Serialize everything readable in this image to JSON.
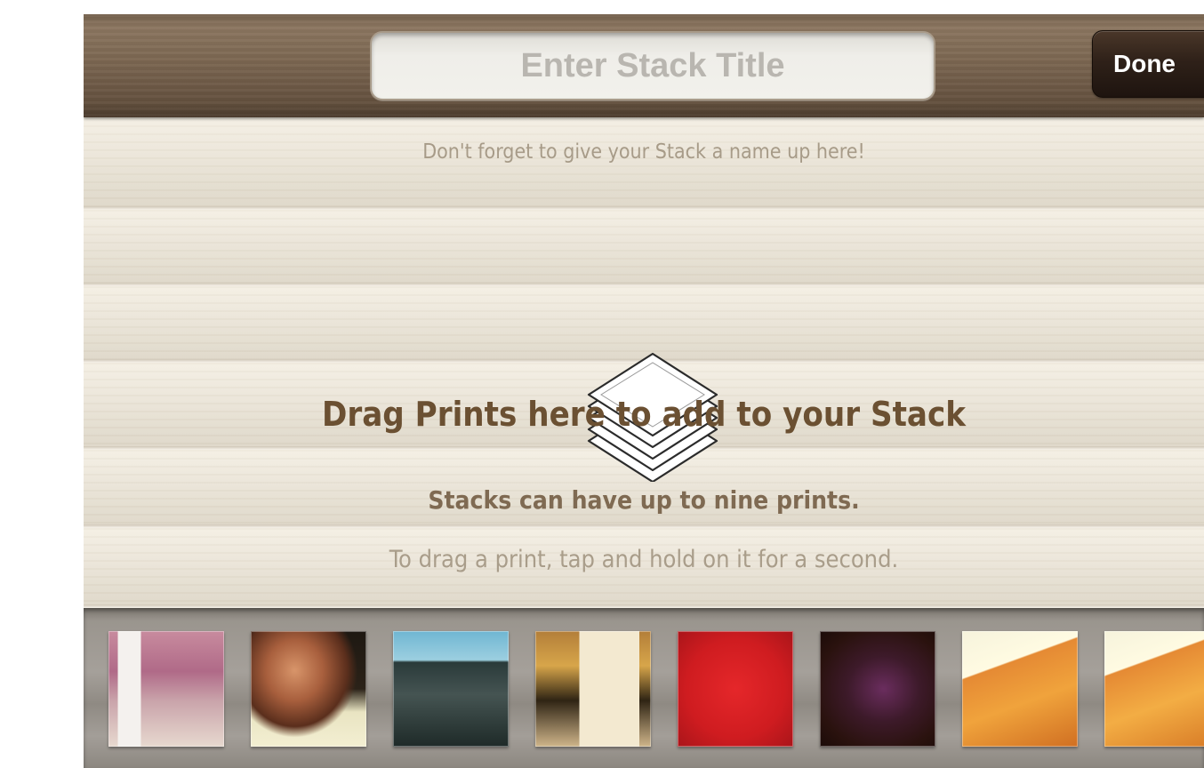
{
  "header": {
    "title_placeholder": "Enter Stack Title",
    "done_label": "Done"
  },
  "board": {
    "name_hint": "Don't forget to give your Stack a name up here!",
    "drag_title": "Drag Prints here to add to your Stack",
    "limit_text": "Stacks can have up to nine prints.",
    "drag_help": "To drag a print, tap and hold on it for a second."
  },
  "icons": {
    "stack": "stack-of-prints-icon"
  },
  "colors": {
    "header_wood": "#7a6550",
    "done_button": "#2f2119",
    "heading_brown": "#6b5032",
    "hint_tan": "#a79b88",
    "strip_gray": "#a5a09a"
  }
}
